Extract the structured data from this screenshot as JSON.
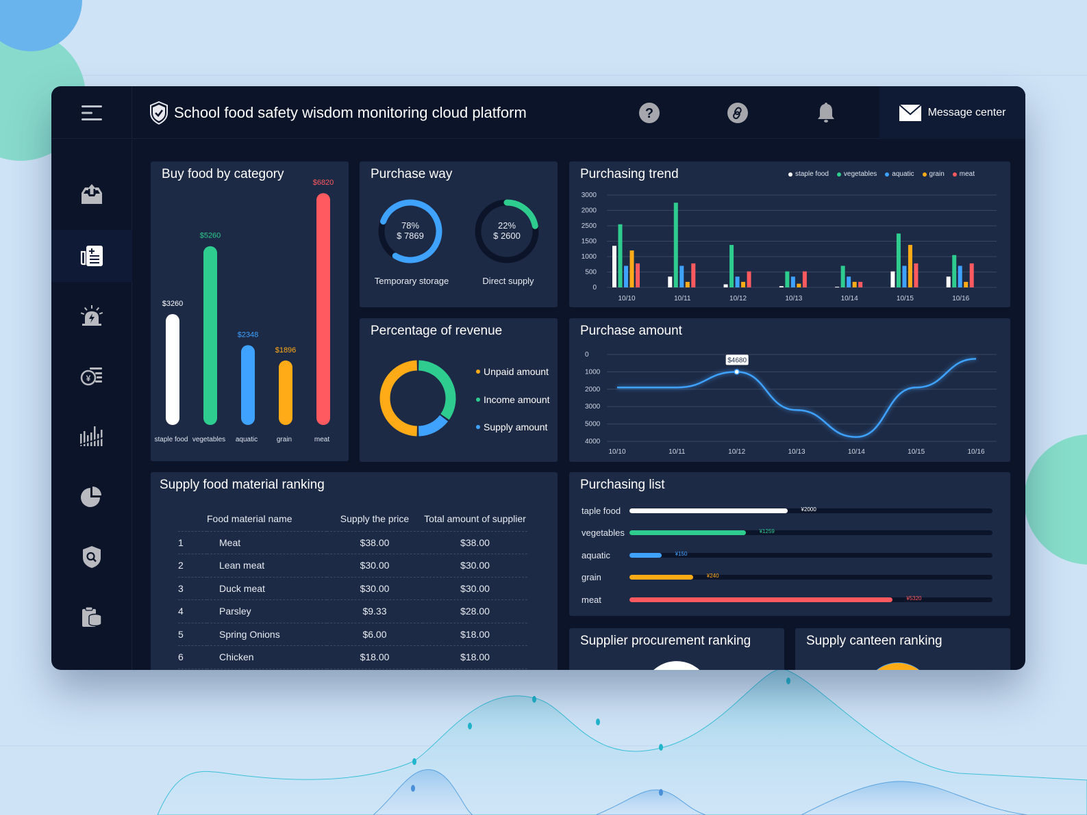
{
  "header": {
    "title": "School food safety wisdom monitoring cloud platform",
    "message_center_label": "Message center",
    "icons": [
      "menu-icon",
      "shield-check-icon",
      "help-icon",
      "link-icon",
      "bell-icon",
      "mail-icon"
    ]
  },
  "sidebar": {
    "items": [
      {
        "icon": "inbox-upload-icon",
        "active": false
      },
      {
        "icon": "add-list-icon",
        "active": true
      },
      {
        "icon": "alarm-icon",
        "active": false
      },
      {
        "icon": "coins-icon",
        "active": false
      },
      {
        "icon": "bar-stats-icon",
        "active": false
      },
      {
        "icon": "pie-chart-icon",
        "active": false
      },
      {
        "icon": "shield-search-icon",
        "active": false
      },
      {
        "icon": "clipboard-database-icon",
        "active": false
      }
    ]
  },
  "colors": {
    "staple": "#ffffff",
    "vegetables": "#2ecc8f",
    "aquatic": "#3fa2ff",
    "grain": "#ffab17",
    "meat": "#ff5a5f"
  },
  "buy_food": {
    "title": "Buy food by category"
  },
  "purchase_way": {
    "title": "Purchase way",
    "items": [
      {
        "pct_label": "78%",
        "amount_label": "$ 7869",
        "name": "Temporary storage",
        "fraction": 0.78,
        "color": "#3fa2ff"
      },
      {
        "pct_label": "22%",
        "amount_label": "$ 2600",
        "name": "Direct supply",
        "fraction": 0.22,
        "color": "#2ecc8f"
      }
    ]
  },
  "revenue": {
    "title": "Percentage of revenue",
    "legend": [
      {
        "label": "Unpaid amount",
        "color": "#ffab17"
      },
      {
        "label": "Income amount",
        "color": "#2ecc8f"
      },
      {
        "label": "Supply amount",
        "color": "#3fa2ff"
      }
    ]
  },
  "trend": {
    "title": "Purchasing trend"
  },
  "amount": {
    "title": "Purchase amount"
  },
  "ranking": {
    "title": "Supply food material ranking",
    "columns": [
      "Food material name",
      "Supply the price",
      "Total amount of supplier"
    ],
    "rows": [
      {
        "rank": "1",
        "name": "Meat",
        "price": "$38.00",
        "total": "$38.00"
      },
      {
        "rank": "2",
        "name": "Lean meat",
        "price": "$30.00",
        "total": "$30.00"
      },
      {
        "rank": "3",
        "name": "Duck meat",
        "price": "$30.00",
        "total": "$30.00"
      },
      {
        "rank": "4",
        "name": "Parsley",
        "price": "$9.33",
        "total": "$28.00"
      },
      {
        "rank": "5",
        "name": "Spring Onions",
        "price": "$6.00",
        "total": "$18.00"
      },
      {
        "rank": "6",
        "name": "Chicken",
        "price": "$18.00",
        "total": "$18.00"
      }
    ]
  },
  "purchasing_list": {
    "title": "Purchasing list",
    "items": [
      {
        "label": "taple food",
        "value_label": "¥2000",
        "fraction": 0.435,
        "color": "#ffffff"
      },
      {
        "label": "vegetables",
        "value_label": "¥1259",
        "fraction": 0.32,
        "color": "#2ecc8f"
      },
      {
        "label": "aquatic",
        "value_label": "¥150",
        "fraction": 0.088,
        "color": "#3fa2ff"
      },
      {
        "label": "grain",
        "value_label": "¥240",
        "fraction": 0.175,
        "color": "#ffab17"
      },
      {
        "label": "meat",
        "value_label": "¥5320",
        "fraction": 0.725,
        "color": "#ff5a5f"
      }
    ]
  },
  "supplier_ranking": {
    "title": "Supplier procurement ranking"
  },
  "canteen_ranking": {
    "title": "Supply canteen ranking"
  },
  "chart_data": [
    {
      "type": "bar",
      "title": "Buy food by category",
      "categories": [
        "staple food",
        "vegetables",
        "aquatic",
        "grain",
        "meat"
      ],
      "values": [
        3260,
        5260,
        2348,
        1896,
        6820
      ],
      "value_labels": [
        "$3260",
        "$5260",
        "$2348",
        "$1896",
        "$6820"
      ],
      "colors": [
        "#ffffff",
        "#2ecc8f",
        "#3fa2ff",
        "#ffab17",
        "#ff5a5f"
      ],
      "ylim": [
        0,
        7000
      ]
    },
    {
      "type": "pie",
      "title": "Percentage of revenue",
      "labels": [
        "Unpaid amount",
        "Income amount",
        "Supply amount"
      ],
      "values": [
        50,
        35,
        15
      ],
      "colors": [
        "#ffab17",
        "#2ecc8f",
        "#3fa2ff"
      ]
    },
    {
      "type": "bar",
      "title": "Purchasing trend",
      "categories": [
        "10/10",
        "10/11",
        "10/12",
        "10/13",
        "10/14",
        "10/15",
        "10/16"
      ],
      "ytick_labels": [
        "0",
        "500",
        "1000",
        "1500",
        "2500",
        "2000",
        "3000"
      ],
      "ylim": [
        0,
        3000
      ],
      "grid": true,
      "legend_position": "top-right",
      "series": [
        {
          "name": "staple food",
          "color": "#ffffff",
          "values": [
            1350,
            350,
            100,
            40,
            20,
            520,
            350
          ]
        },
        {
          "name": "vegetables",
          "color": "#2ecc8f",
          "values": [
            2050,
            2750,
            1380,
            520,
            700,
            1750,
            1050
          ]
        },
        {
          "name": "aquatic",
          "color": "#3fa2ff",
          "values": [
            700,
            700,
            350,
            350,
            350,
            700,
            700
          ]
        },
        {
          "name": "grain",
          "color": "#ffab17",
          "values": [
            1200,
            180,
            180,
            120,
            180,
            1380,
            180
          ]
        },
        {
          "name": "meat",
          "color": "#ff5a5f",
          "values": [
            780,
            780,
            520,
            520,
            180,
            780,
            780
          ]
        }
      ]
    },
    {
      "type": "line",
      "title": "Purchase amount",
      "x": [
        "10/10",
        "10/11",
        "10/12",
        "10/13",
        "10/14",
        "10/15",
        "10/16"
      ],
      "ytick_labels": [
        "0",
        "1000",
        "2000",
        "3000",
        "5000",
        "4000"
      ],
      "ylim": [
        0,
        5000
      ],
      "grid": true,
      "series": [
        {
          "name": "Purchase amount",
          "color": "#3fa2ff",
          "values": [
            3100,
            3100,
            4000,
            1800,
            250,
            3100,
            4750
          ]
        }
      ],
      "annotation": {
        "x": "10/12",
        "label": "$4680"
      }
    }
  ]
}
